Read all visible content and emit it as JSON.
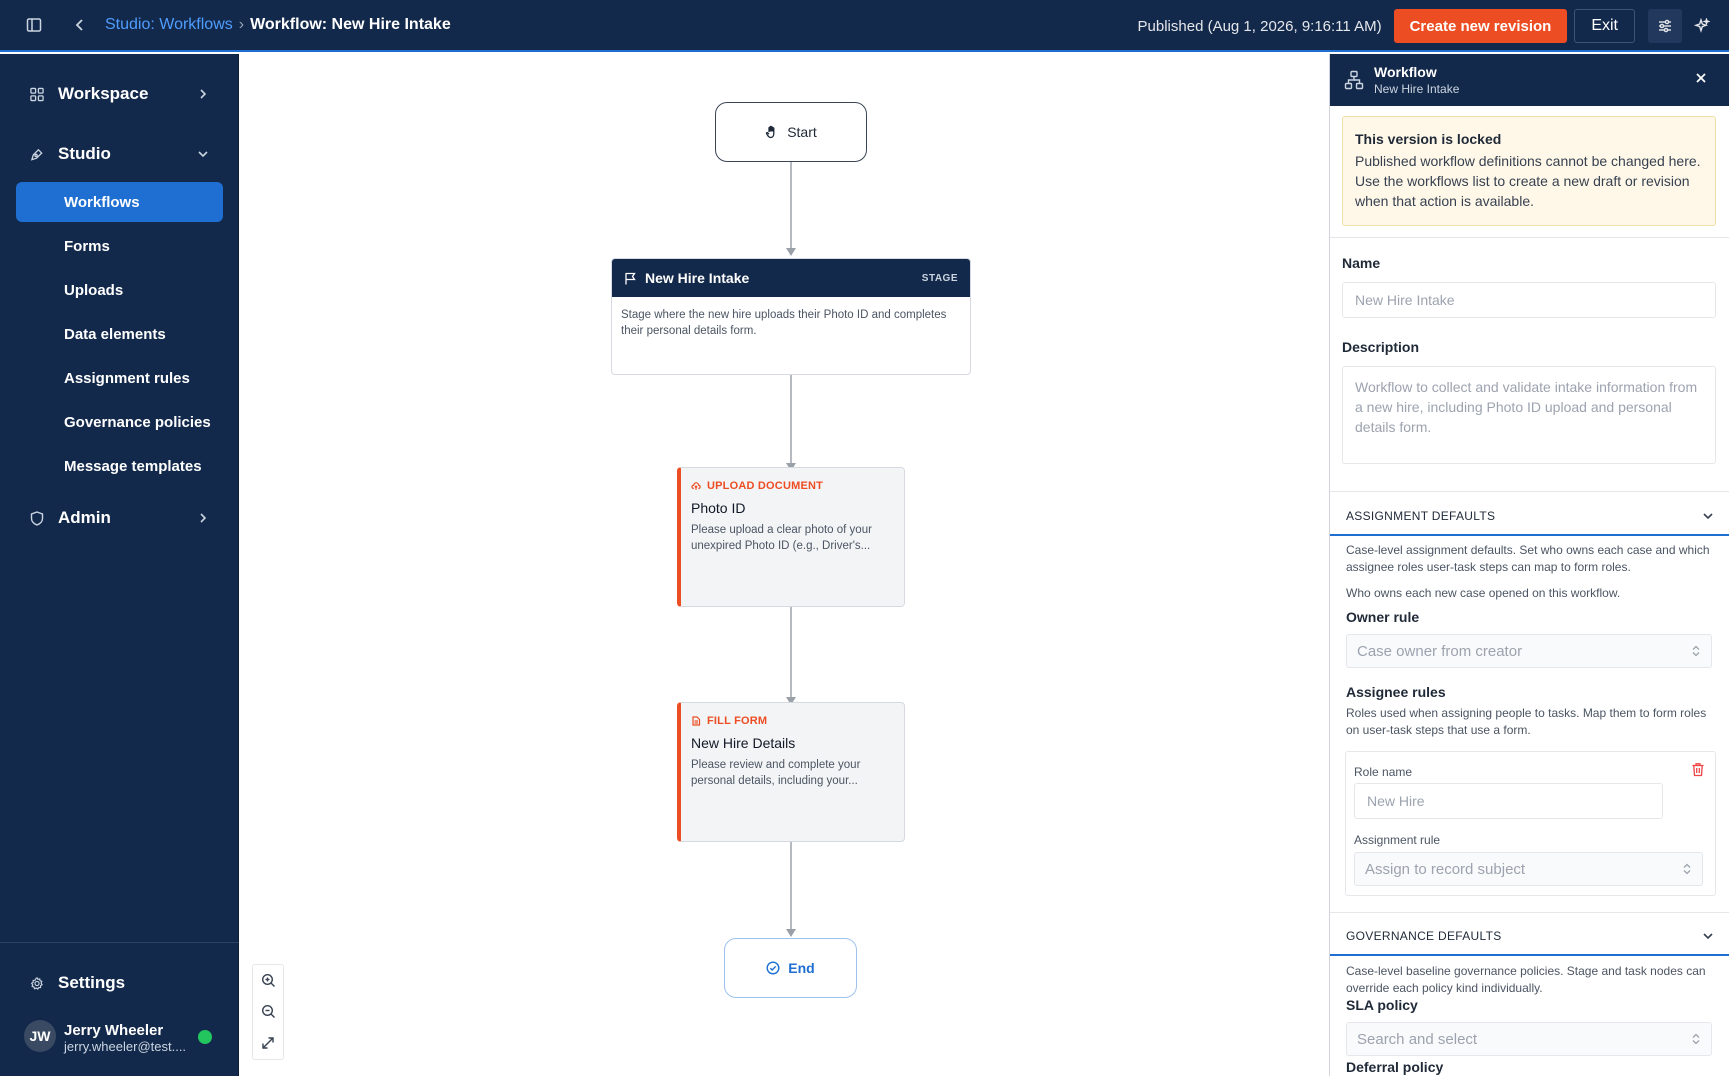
{
  "topbar": {
    "breadcrumb_parent": "Studio: Workflows",
    "breadcrumb_separator": "›",
    "breadcrumb_current": "Workflow: New Hire Intake",
    "status": "Published (Aug 1, 2026, 9:16:11 AM)",
    "create_revision_label": "Create new revision",
    "exit_label": "Exit"
  },
  "sidebar": {
    "workspace_label": "Workspace",
    "studio_label": "Studio",
    "studio_items": [
      {
        "label": "Workflows",
        "active": true
      },
      {
        "label": "Forms"
      },
      {
        "label": "Uploads"
      },
      {
        "label": "Data elements"
      },
      {
        "label": "Assignment rules"
      },
      {
        "label": "Governance policies"
      },
      {
        "label": "Message templates"
      }
    ],
    "admin_label": "Admin",
    "settings_label": "Settings",
    "user": {
      "initials": "JW",
      "name": "Jerry Wheeler",
      "email": "jerry.wheeler@test...."
    }
  },
  "canvas": {
    "start_label": "Start",
    "end_label": "End",
    "stage": {
      "title": "New Hire Intake",
      "badge": "STAGE",
      "description": "Stage where the new hire uploads their Photo ID and completes their personal details form."
    },
    "tasks": [
      {
        "type": "UPLOAD DOCUMENT",
        "name": "Photo ID",
        "description": "Please upload a clear photo of your unexpired Photo ID (e.g., Driver's..."
      },
      {
        "type": "FILL FORM",
        "name": "New Hire Details",
        "description": "Please review and complete your personal details, including your..."
      }
    ]
  },
  "panel": {
    "title": "Workflow",
    "subtitle": "New Hire Intake",
    "lock_title": "This version is locked",
    "lock_text": "Published workflow definitions cannot be changed here. Use the workflows list to create a new draft or revision when that action is available.",
    "name_label": "Name",
    "name_value": "New Hire Intake",
    "description_label": "Description",
    "description_value": "Workflow to collect and validate intake information from a new hire, including Photo ID upload and personal details form.",
    "assignment": {
      "header": "ASSIGNMENT DEFAULTS",
      "intro": "Case-level assignment defaults. Set who owns each case and which assignee roles user-task steps can map to form roles.",
      "owner_hint": "Who owns each new case opened on this workflow.",
      "owner_label": "Owner rule",
      "owner_value": "Case owner from creator",
      "assignee_label": "Assignee rules",
      "assignee_hint": "Roles used when assigning people to tasks. Map them to form roles on user-task steps that use a form.",
      "role_name_label": "Role name",
      "role_name_value": "New Hire",
      "assignment_rule_label": "Assignment rule",
      "assignment_rule_value": "Assign to record subject"
    },
    "governance": {
      "header": "GOVERNANCE DEFAULTS",
      "intro": "Case-level baseline governance policies. Stage and task nodes can override each policy kind individually.",
      "sla_label": "SLA policy",
      "sla_placeholder": "Search and select",
      "deferral_label": "Deferral policy"
    }
  },
  "colors": {
    "navy": "#13294b",
    "accent_blue": "#1e6fd1",
    "accent_orange": "#ec4d22",
    "online_green": "#22c55e",
    "lock_bg": "#fff8e8"
  }
}
